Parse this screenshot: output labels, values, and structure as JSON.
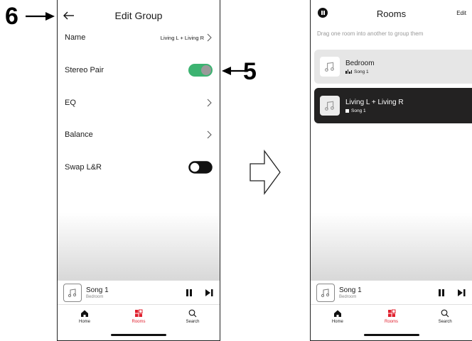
{
  "callouts": {
    "step_back": "6",
    "step_toggle": "5"
  },
  "edit_group": {
    "title": "Edit Group",
    "rows": [
      {
        "label": "Name",
        "value": "Living L + Living R"
      },
      {
        "label": "Stereo Pair",
        "toggle": true
      },
      {
        "label": "EQ"
      },
      {
        "label": "Balance"
      },
      {
        "label": "Swap L&R",
        "toggle": false
      }
    ],
    "now_playing": {
      "title": "Song 1",
      "room": "Bedroom"
    },
    "tabs": [
      {
        "label": "Home",
        "icon": "home-icon"
      },
      {
        "label": "Rooms",
        "icon": "rooms-icon",
        "active": true
      },
      {
        "label": "Search",
        "icon": "search-icon"
      }
    ]
  },
  "rooms": {
    "title": "Rooms",
    "edit_label": "Edit",
    "hint": "Drag one room into another to group them",
    "cards": [
      {
        "name": "Bedroom",
        "song": "Song 1",
        "state": "playing"
      },
      {
        "name": "Living L + Living R",
        "song": "Song 1",
        "state": "stopped"
      }
    ],
    "now_playing": {
      "title": "Song 1",
      "room": "Bedroom"
    },
    "tabs": [
      {
        "label": "Home",
        "icon": "home-icon"
      },
      {
        "label": "Rooms",
        "icon": "rooms-icon",
        "active": true
      },
      {
        "label": "Search",
        "icon": "search-icon"
      }
    ]
  },
  "colors": {
    "accent_red": "#e0202e",
    "toggle_on": "#3cb371",
    "dark_card": "#232222"
  }
}
